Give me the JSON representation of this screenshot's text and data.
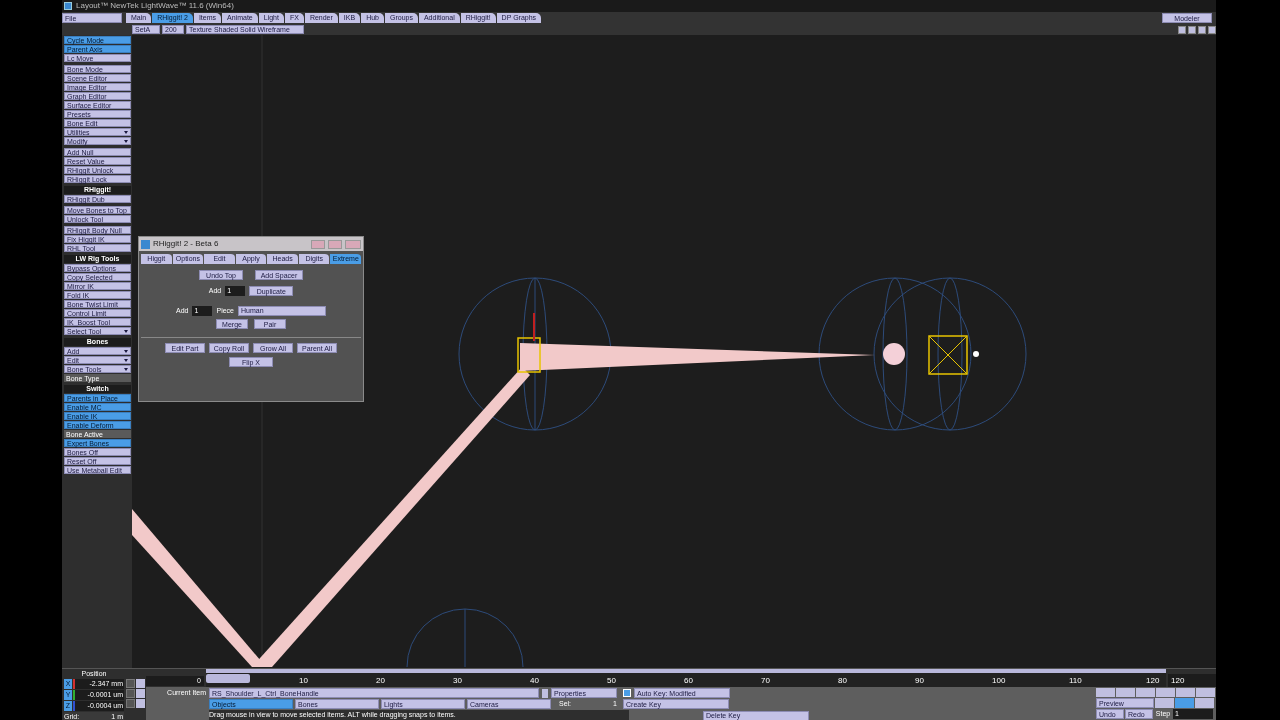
{
  "window": {
    "title": "Layout™ NewTek LightWave™ 11.6 (Win64)"
  },
  "menu_dropdown": {
    "label": "File"
  },
  "tabs": [
    {
      "label": "Main",
      "selected": false
    },
    {
      "label": "RHiggit! 2",
      "selected": true
    },
    {
      "label": "Items",
      "selected": false
    },
    {
      "label": "Animate",
      "selected": false
    },
    {
      "label": "Light",
      "selected": false
    },
    {
      "label": "FX",
      "selected": false
    },
    {
      "label": "Render",
      "selected": false
    },
    {
      "label": "IKB",
      "selected": false
    },
    {
      "label": "Hub",
      "selected": false
    },
    {
      "label": "Groups",
      "selected": false
    },
    {
      "label": "Additional",
      "selected": false
    },
    {
      "label": "RHiggit!",
      "selected": false
    },
    {
      "label": "DP Graphs",
      "selected": false
    }
  ],
  "modeler_button": "Modeler",
  "toolbar": {
    "view_layout": "SetA",
    "zoom": "200",
    "render_mode": "Texture Shaded Solid Wireframe"
  },
  "sidebar": {
    "groups": [
      {
        "items": [
          {
            "kind": "toggle",
            "label": "Cycle Mode",
            "on": true
          },
          {
            "kind": "toggle",
            "label": "Parent Axis",
            "on": true
          },
          {
            "kind": "button",
            "label": "Lc Move"
          }
        ]
      },
      {
        "items": [
          {
            "kind": "button",
            "label": "Bone Mode"
          },
          {
            "kind": "button",
            "label": "Scene Editor"
          },
          {
            "kind": "button",
            "label": "Image Editor"
          },
          {
            "kind": "button",
            "label": "Graph Editor"
          },
          {
            "kind": "button",
            "label": "Surface Editor"
          },
          {
            "kind": "button",
            "label": "Presets"
          },
          {
            "kind": "button",
            "label": "Bone Edit"
          },
          {
            "kind": "dropdown",
            "label": "Utilities"
          },
          {
            "kind": "dropdown",
            "label": "Modify"
          }
        ]
      },
      {
        "items": [
          {
            "kind": "button",
            "label": "Add Null"
          },
          {
            "kind": "button",
            "label": "Reset Value"
          },
          {
            "kind": "button",
            "label": "RHiggit Unlock"
          },
          {
            "kind": "button",
            "label": "RHiggit Lock"
          }
        ]
      },
      {
        "header": "RHiggit!",
        "items": [
          {
            "kind": "button",
            "label": "RHiggit Dub"
          }
        ]
      },
      {
        "items": [
          {
            "kind": "button",
            "label": "Move Bones to Top"
          },
          {
            "kind": "button",
            "label": "Unlock Tool"
          }
        ]
      },
      {
        "items": [
          {
            "kind": "button",
            "label": "RHiggit Body Null"
          },
          {
            "kind": "button",
            "label": "Fix Higgit IK"
          },
          {
            "kind": "button",
            "label": "RHL Tool"
          }
        ]
      },
      {
        "header": "LW Rig Tools",
        "items": [
          {
            "kind": "button",
            "label": "Bypass Options"
          },
          {
            "kind": "button",
            "label": "Copy Selected"
          },
          {
            "kind": "button",
            "label": "Mirror IK"
          },
          {
            "kind": "button",
            "label": "Fold IK"
          },
          {
            "kind": "button",
            "label": "Bone Twist Limit"
          },
          {
            "kind": "button",
            "label": "Control Limit"
          },
          {
            "kind": "button",
            "label": "IK_Boost Tool"
          },
          {
            "kind": "dropdown",
            "label": "Select Tool"
          }
        ]
      },
      {
        "header": "Bones",
        "items": [
          {
            "kind": "dropdown",
            "label": "Add"
          },
          {
            "kind": "dropdown",
            "label": "Edit"
          },
          {
            "kind": "dropdown",
            "label": "Bone Tools"
          },
          {
            "kind": "label",
            "label": "Bone Type"
          }
        ]
      },
      {
        "header": "Switch",
        "items": [
          {
            "kind": "toggle",
            "label": "Parents in Place",
            "on": true
          },
          {
            "kind": "toggle",
            "label": "Enable MC",
            "on": true
          },
          {
            "kind": "toggle",
            "label": "Enable IK",
            "on": true
          },
          {
            "kind": "toggle",
            "label": "Enable Deform",
            "on": true
          },
          {
            "kind": "label",
            "label": "Bone Active"
          },
          {
            "kind": "toggle",
            "label": "Expert Bones",
            "on": true
          },
          {
            "kind": "toggle",
            "label": "Bones Off",
            "on": false
          },
          {
            "kind": "toggle",
            "label": "Reset Off",
            "on": false
          },
          {
            "kind": "toggle",
            "label": "Use Metaball Edit",
            "on": false
          }
        ]
      }
    ]
  },
  "dialog": {
    "title": "RHiggit! 2 - Beta 6",
    "tabs": [
      {
        "label": "Higgit",
        "selected": false
      },
      {
        "label": "Options",
        "selected": false
      },
      {
        "label": "Edit",
        "selected": false
      },
      {
        "label": "Apply",
        "selected": false
      },
      {
        "label": "Heads",
        "selected": false
      },
      {
        "label": "Digits",
        "selected": false
      },
      {
        "label": "Extreme",
        "selected": true
      }
    ],
    "undo_button": "Undo Top",
    "spacer_button": "Add Spacer",
    "add_label_1": "Add",
    "add_count_1": "1",
    "duplicate_button": "Duplicate",
    "add_label_2": "Add",
    "add_count_2": "1",
    "piece_label": "Piece",
    "piece_value": "Human",
    "merge_button": "Merge",
    "pair_button": "Pair",
    "bottom_buttons": [
      "Edit Part",
      "Copy Roll",
      "Grow All",
      "Parent All"
    ],
    "flip_button": "Flip X"
  },
  "position": {
    "title": "Position",
    "axes": [
      {
        "axis": "X",
        "value": "-2.347 mm"
      },
      {
        "axis": "Y",
        "value": "-0.0001 um"
      },
      {
        "axis": "Z",
        "value": "-0.0004 um"
      }
    ],
    "grid_label": "Grid:",
    "grid_value": "1 m"
  },
  "timeline": {
    "start_frame": "0",
    "ticks": [
      "10",
      "20",
      "30",
      "40",
      "50",
      "60",
      "70",
      "80",
      "90",
      "100",
      "110",
      "120"
    ],
    "end_frame": "120",
    "level": 0
  },
  "item_bar": {
    "current_item_label": "Current Item",
    "current_item": "RS_Shoulder_L_Ctrl_BoneHandle",
    "properties": "Properties",
    "item_types": [
      {
        "label": "Objects",
        "selected": true
      },
      {
        "label": "Bones",
        "selected": false
      },
      {
        "label": "Lights",
        "selected": false
      },
      {
        "label": "Cameras",
        "selected": false
      }
    ],
    "sel_label": "Sel:",
    "sel_value": "1",
    "auto_key": {
      "label": "Auto Key: Modified",
      "checked": true
    },
    "create_key": "Create Key",
    "delete_key": "Delete Key",
    "status": "Drag mouse in view to move selected items. ALT while dragging snaps to items."
  },
  "playback": {
    "preview": "Preview",
    "undo": "Undo",
    "redo": "Redo",
    "step_label": "Step",
    "step_value": "1"
  }
}
